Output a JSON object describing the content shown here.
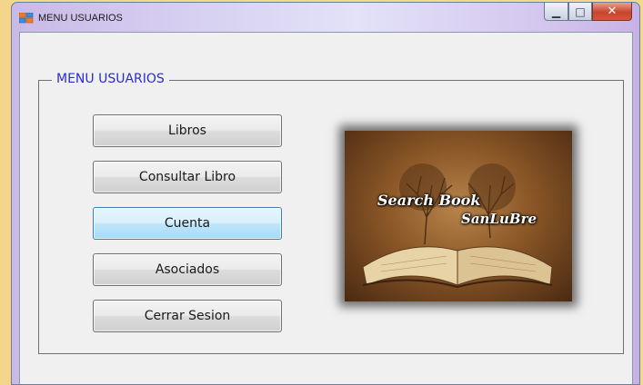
{
  "window": {
    "title": "MENU USUARIOS",
    "controls": {
      "minimize": "▁",
      "maximize": "□",
      "close": "✕"
    }
  },
  "group": {
    "legend": "MENU USUARIOS"
  },
  "buttons": {
    "libros": "Libros",
    "consultar_libro": "Consultar Libro",
    "cuenta": "Cuenta",
    "asociados": "Asociados",
    "cerrar_sesion": "Cerrar Sesion"
  },
  "logo": {
    "line1": "Search Book",
    "line2": "SanLuBre"
  },
  "colors": {
    "legend": "#2b2bd6",
    "hover_button": "#bee6fd"
  },
  "icons": {
    "app": "form-icon",
    "logo": "book-tree-icon"
  }
}
